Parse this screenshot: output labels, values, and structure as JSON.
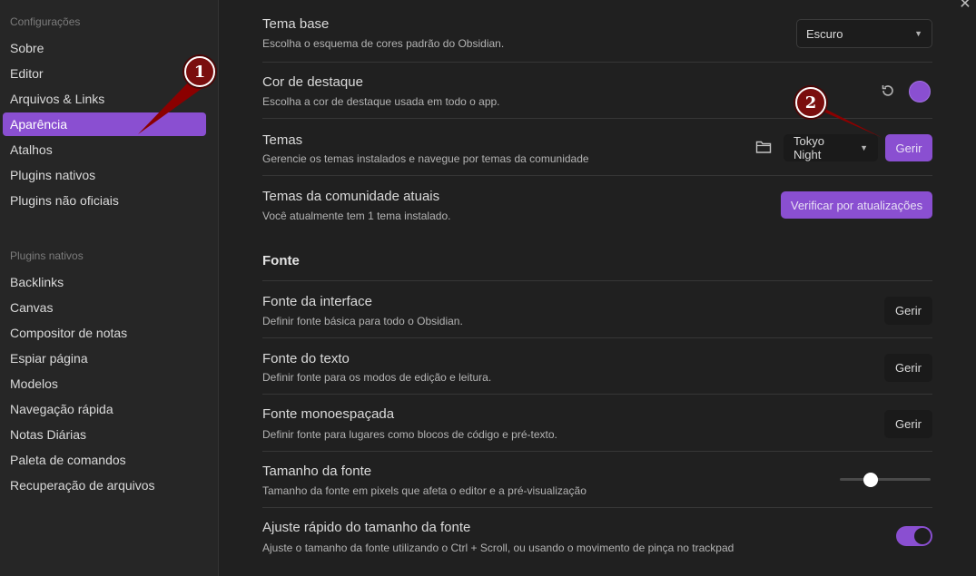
{
  "sidebar": {
    "heading_settings": "Configurações",
    "settings_items": [
      {
        "label": "Sobre"
      },
      {
        "label": "Editor"
      },
      {
        "label": "Arquivos & Links"
      },
      {
        "label": "Aparência"
      },
      {
        "label": "Atalhos"
      },
      {
        "label": "Plugins nativos"
      },
      {
        "label": "Plugins não oficiais"
      }
    ],
    "active_index": 3,
    "heading_plugins": "Plugins nativos",
    "plugin_items": [
      {
        "label": "Backlinks"
      },
      {
        "label": "Canvas"
      },
      {
        "label": "Compositor de notas"
      },
      {
        "label": "Espiar página"
      },
      {
        "label": "Modelos"
      },
      {
        "label": "Navegação rápida"
      },
      {
        "label": "Notas Diárias"
      },
      {
        "label": "Paleta de comandos"
      },
      {
        "label": "Recuperação de arquivos"
      }
    ]
  },
  "window": {
    "close_symbol": "✕"
  },
  "settings": {
    "base_theme": {
      "name": "Tema base",
      "desc": "Escolha o esquema de cores padrão do Obsidian.",
      "value": "Escuro"
    },
    "accent_color": {
      "name": "Cor de destaque",
      "desc": "Escolha a cor de destaque usada em todo o app.",
      "color": "#8a4fd1"
    },
    "themes": {
      "name": "Temas",
      "desc": "Gerencie os temas instalados e navegue por temas da comunidade",
      "value": "Tokyo Night",
      "button": "Gerir"
    },
    "community_themes": {
      "name": "Temas da comunidade atuais",
      "desc": "Você atualmente tem 1 tema instalado.",
      "button": "Verificar por atualizações"
    },
    "font_section": "Fonte",
    "interface_font": {
      "name": "Fonte da interface",
      "desc": "Definir fonte básica para todo o Obsidian.",
      "button": "Gerir"
    },
    "text_font": {
      "name": "Fonte do texto",
      "desc": "Definir fonte para os modos de edição e leitura.",
      "button": "Gerir"
    },
    "mono_font": {
      "name": "Fonte monoespaçada",
      "desc": "Definir fonte para lugares como blocos de código e pré-texto.",
      "button": "Gerir"
    },
    "font_size": {
      "name": "Tamanho da fonte",
      "desc": "Tamanho da fonte em pixels que afeta o editor e a pré-visualização",
      "slider_fraction": 0.34
    },
    "quick_font": {
      "name": "Ajuste rápido do tamanho da fonte",
      "desc": "Ajuste o tamanho da fonte utilizando o Ctrl + Scroll, ou usando o movimento de pinça no trackpad",
      "enabled": true
    }
  },
  "annotations": {
    "callout_1": "1",
    "callout_2": "2",
    "arrow_color": "#8b0000"
  },
  "icons": {
    "reset": "reset-icon",
    "folder": "folder-icon",
    "caret": "chevron-down-icon",
    "close": "close-icon"
  }
}
